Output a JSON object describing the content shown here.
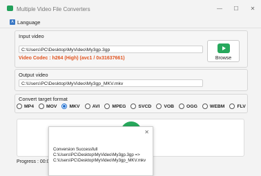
{
  "window": {
    "title": "Multiple Video File Converters",
    "minimize": "—",
    "maximize": "☐",
    "close": "✕"
  },
  "menu": {
    "language_label": "Language"
  },
  "input": {
    "section_label": "Input video",
    "path": "C:\\Users\\PC\\Desktop\\MyVideo\\My3gp.3gp",
    "codec_text": "Video Codec : h264 (High)  (avc1 / 0x31637661)",
    "browse_label": "Browse"
  },
  "output": {
    "section_label": "Output video",
    "path": "C:\\Users\\PC\\Desktop\\MyVideo\\My3gp_MKV.mkv"
  },
  "format": {
    "section_label": "Convert target format",
    "options": [
      "MP4",
      "MOV",
      "MKV",
      "AVI",
      "MPEG",
      "SVCD",
      "VOB",
      "OGG",
      "WEBM",
      "FLV"
    ],
    "selected": "MKV"
  },
  "progress": {
    "label": "Progress : 00:03"
  },
  "dialog": {
    "close": "✕",
    "line1": "Conversion Successfull",
    "line2": "C:\\Users\\PC\\Desktop\\MyVideo\\My3gp.3gp =>",
    "line3": "C:\\Users\\PC\\Desktop\\MyVideo\\My3gp_MKV.mkv"
  },
  "colors": {
    "accent": "#27a85c",
    "codec": "#e0531f",
    "radio": "#1f6fd1"
  }
}
